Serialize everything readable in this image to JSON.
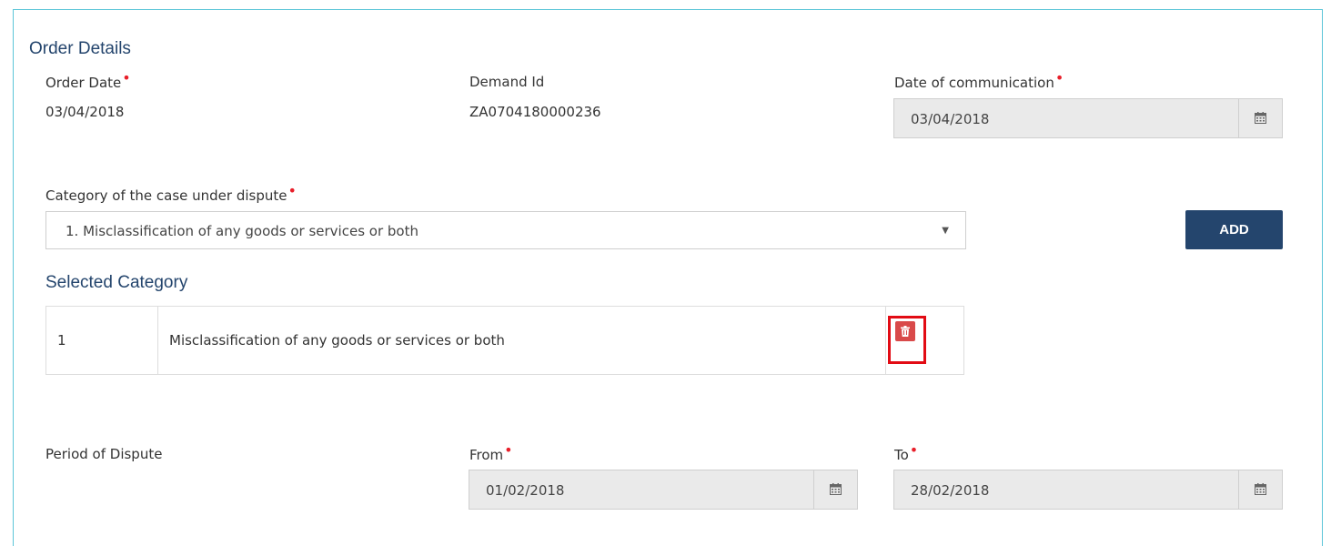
{
  "order_details": {
    "heading": "Order Details",
    "order_date": {
      "label": "Order Date",
      "value": "03/04/2018",
      "required": true
    },
    "demand_id": {
      "label": "Demand Id",
      "value": "ZA0704180000236"
    },
    "date_of_communication": {
      "label": "Date of communication",
      "value": "03/04/2018",
      "required": true,
      "icon": "calendar-icon"
    }
  },
  "category": {
    "label": "Category of the case under dispute",
    "required": true,
    "selected_option": "1. Misclassification of any goods or services or both",
    "dropdown_icon": "caret-down-icon",
    "add_button_label": "ADD"
  },
  "selected_category": {
    "heading": "Selected Category",
    "rows": [
      {
        "number": "1",
        "description": "Misclassification of any goods or services or both",
        "action_icon": "trash-icon"
      }
    ]
  },
  "period_of_dispute": {
    "label": "Period of Dispute",
    "from": {
      "label": "From",
      "value": "01/02/2018",
      "required": true,
      "icon": "calendar-icon"
    },
    "to": {
      "label": "To",
      "value": "28/02/2018",
      "required": true,
      "icon": "calendar-icon"
    }
  },
  "colors": {
    "accent": "#24456d",
    "required_marker": "#e81f2a",
    "delete_button": "#d94a4a",
    "highlight_border": "#e20b14",
    "panel_border": "#5bc5d8",
    "disabled_input_bg": "#eaeaea"
  },
  "glyphs": {
    "required_marker": "•",
    "dropdown_caret": "▼"
  }
}
